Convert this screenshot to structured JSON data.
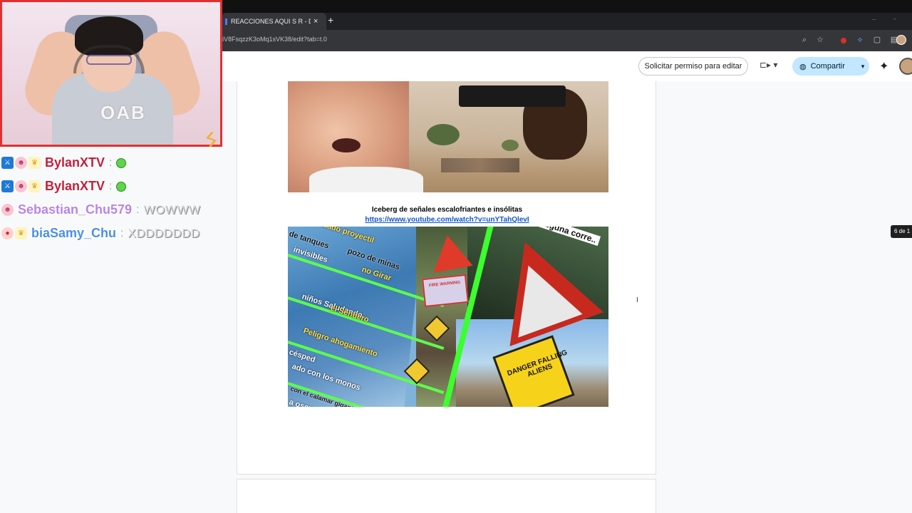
{
  "browser": {
    "tab_title": "REACCIONES AQUI S R - Docum",
    "tab_close": "×",
    "new_tab": "+",
    "url": "iV8FsqzzK3oMq1sVK38/edit?tab=t.0"
  },
  "docs_toolbar": {
    "request_edit_label": "Solicitar permiso para editar",
    "share_label": "Compartir"
  },
  "document": {
    "video_title": "Iceberg de señales escalofriantes e insólitas",
    "video_link": "https://www.youtube.com/watch?v=unYTahQlevI",
    "thumbnail_texts": {
      "corner": "alguna corre..",
      "tags": [
        "de tanques",
        "cuidado proyectil",
        "invisibles",
        "pozo de minas",
        "no Girar",
        "niños Saludando",
        "el Sendero",
        "Peligro ahogamiento",
        "césped",
        "ado con los monos",
        "con el calamar gigante",
        "a oscuridad"
      ],
      "danger_sign": "DANGER FALLING ALIENS",
      "fire_sign": "FIRE WARNING"
    },
    "page_counter": "6 de 1"
  },
  "stream_overlay": {
    "shirt_text": "OAB",
    "chat": [
      {
        "user": "BylanXTV",
        "color": "#c41e3a",
        "badges": [
          "mod",
          "fc",
          "crown"
        ],
        "message": "",
        "has_emote": true
      },
      {
        "user": "BylanXTV",
        "color": "#c41e3a",
        "badges": [
          "mod",
          "fc",
          "crown"
        ],
        "message": "",
        "has_emote": true
      },
      {
        "user": "Sebastian_Chu579",
        "color": "#b784e8",
        "badges": [
          "fc"
        ],
        "message": "WOWWW",
        "has_emote": false
      },
      {
        "user": "biaSamy_Chu",
        "color": "#4a8fe8",
        "badges": [
          "strawberry",
          "crown"
        ],
        "message": "XDDDDDDD",
        "has_emote": false
      }
    ]
  },
  "colors": {
    "share_bg": "#c2e7ff",
    "webcam_border": "#e23030",
    "link": "#1155cc"
  }
}
